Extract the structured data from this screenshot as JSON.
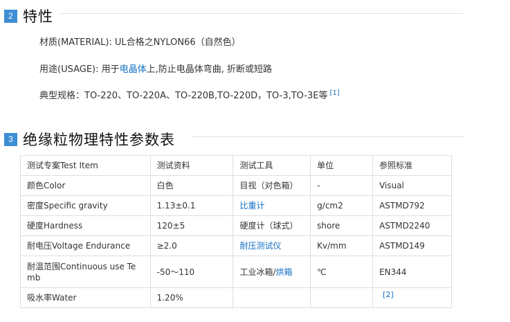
{
  "section1": {
    "number": "2",
    "title": "特性",
    "material": "材质(MATERIAL): UL合格之NYLON66（自然色）",
    "usage_prefix": "用途(USAGE): 用于",
    "usage_link": "电晶体",
    "usage_suffix": "上,防止电晶体弯曲, 折断或短路",
    "spec": "典型规格：TO-220、TO-220A、TO-220B,TO-220D，TO-3,TO-3E等",
    "spec_ref": "[1]"
  },
  "section2": {
    "number": "3",
    "title": "绝缘粒物理特性参数表"
  },
  "table": {
    "headers": [
      "测试专案Test Item",
      "测试资料",
      "测试工具",
      "单位",
      "参照标准"
    ],
    "rows": [
      [
        "颜色Color",
        "白色",
        "目视（对色箱）",
        "-",
        "Visual"
      ],
      [
        "密度Specific gravity",
        "1.13±0.1",
        "比重计",
        "g/cm2",
        "ASTMD792"
      ],
      [
        "硬度Hardness",
        "120±5",
        "硬度计（球式）",
        "shore",
        "ASTMD2240"
      ],
      [
        "耐电压Voltage Endurance",
        "≥2.0",
        "耐压测试仪",
        "Kv/mm",
        "ASTMD149"
      ],
      [
        "耐温范围Continuous use Temb",
        "-50～110",
        "工业冰箱/",
        "℃",
        "EN344"
      ],
      [
        "吸水率Water",
        "1.20%",
        "",
        "",
        ""
      ]
    ],
    "row5_tool_link": "烘箱",
    "last_ref": "[2]"
  }
}
